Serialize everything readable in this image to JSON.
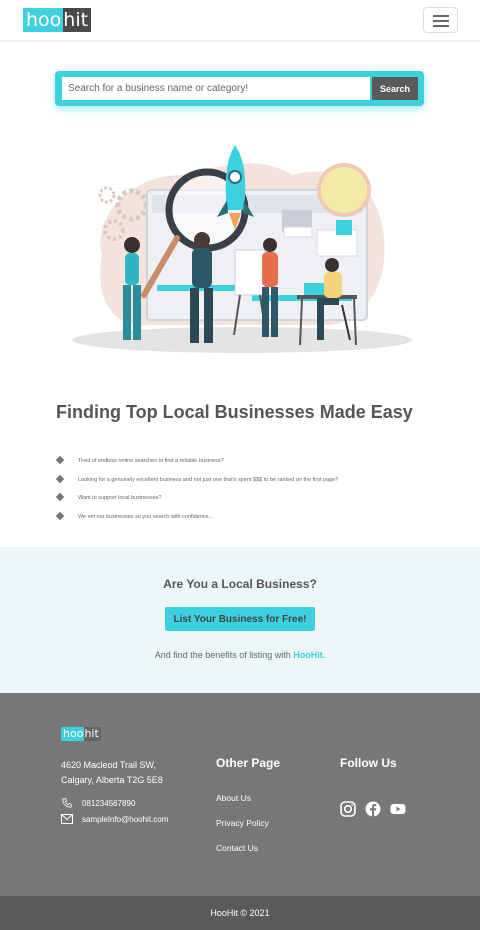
{
  "header": {
    "logo": {
      "part1": "hoo",
      "part2": "hit"
    },
    "menu_icon": "hamburger-menu-icon"
  },
  "search": {
    "placeholder": "Search for a business name or category!",
    "button_label": "Search"
  },
  "hero": {
    "illustration": "team-with-rocket-and-magnifier-illustration",
    "headline": "Finding Top Local Businesses Made Easy",
    "bullets": [
      "Tired of endless online searches to find a reliable business?",
      "Looking for a genuinely excellent business and not just one that's spent $$$ to be ranked on the first page?",
      "Want to support local businesses?",
      "We vet our businesses so you search with confidence..."
    ]
  },
  "local_business": {
    "title": "Are You a Local Business?",
    "button_label": "List Your Business for Free!",
    "note_prefix": "And find the benefits of listing with ",
    "note_brand": "HooHit."
  },
  "footer": {
    "logo": {
      "part1": "hoo",
      "part2": "hit"
    },
    "address_line1": "4620 Macleod Trail SW,",
    "address_line2": "Calgary, Alberta T2G 5E8",
    "phone": "081234567890",
    "email": "sampleInfo@hoohit.com",
    "other_page_title": "Other Page",
    "links": [
      "About Us",
      "Privacy Policy",
      "Contact Us"
    ],
    "follow_title": "Follow Us",
    "social_icons": [
      "instagram-icon",
      "facebook-icon",
      "youtube-icon"
    ]
  },
  "copyright": "HooHit © 2021",
  "colors": {
    "accent": "#3dd1df",
    "dark_gray": "#5a5a5a",
    "footer_bg": "#777777",
    "band_bg": "#ecf7f8"
  }
}
